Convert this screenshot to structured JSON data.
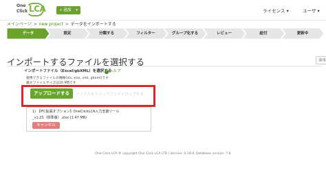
{
  "header": {
    "logo_line1": "One",
    "logo_line2": "Click",
    "logo_brand": "LCA",
    "add_button": "+ 追加",
    "license_menu": "ライセンス",
    "user_menu": "ユーザ"
  },
  "breadcrumb": {
    "items": [
      "メインページ",
      "new project",
      "データをインポートする"
    ],
    "separator": ">"
  },
  "steps": [
    {
      "label": "データ",
      "active": true
    },
    {
      "label": "設定",
      "active": false
    },
    {
      "label": "分類する",
      "active": false
    },
    {
      "label": "フィルター",
      "active": false
    },
    {
      "label": "グループ化する",
      "active": false
    },
    {
      "label": "レビュー",
      "active": false
    },
    {
      "label": "紐付",
      "active": false
    },
    {
      "label": "更新中",
      "active": false
    }
  ],
  "page": {
    "title": "インポートするファイルを選択する",
    "side_button": "戻る",
    "section_label": "インポートファイル（Excel/gbXML）を選択する",
    "help_label": "ヘルプ",
    "hint_line1": "使用できるファイルの種類(xls, xlsx, xml, gbxml)です",
    "hint_line2": "最大ファイルサイズは16 MBです"
  },
  "upload": {
    "button_label": "アップロードする",
    "drop_placeholder": "ファイルをドラッグアンドドロップする"
  },
  "file": {
    "line1": "1)  【IFC拡張オプション】OneClickLCA入力支援ツール",
    "line2": "_v1.23（標準版）.xlsx (1.47 MB)",
    "cancel_label": "キャンセル"
  },
  "footer": {
    "text": "One Click LCA ® copyright One Click LCA LTD | Version: 0.18.0,  Database version: 7.8"
  },
  "colors": {
    "brand_green": "#6aa22d",
    "active_step": "#6aa22d",
    "inactive_step": "#e6e6e6",
    "highlight_red": "#d42a2a",
    "cancel_red": "#e47d7d"
  }
}
